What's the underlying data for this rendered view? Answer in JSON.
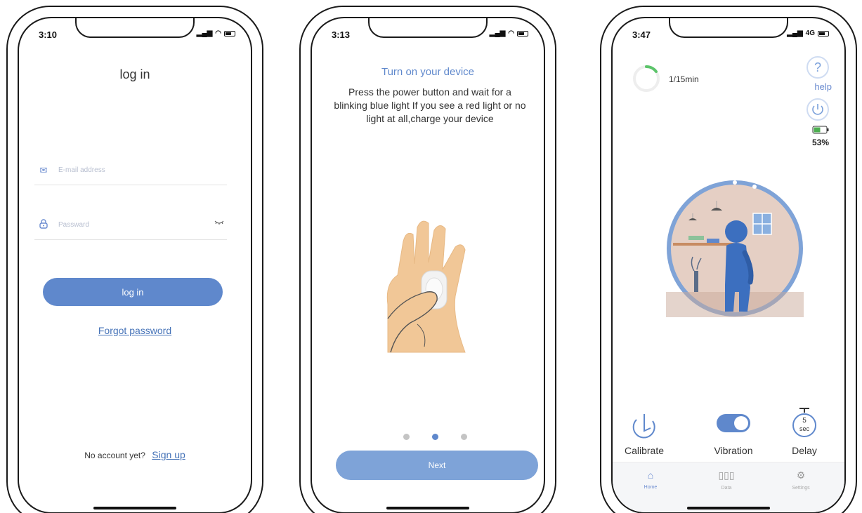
{
  "phones": [
    {
      "time": "3:10",
      "status_icons": [
        "signal-icon",
        "wifi-icon",
        "battery-icon"
      ],
      "title": "log in",
      "email_placeholder": "E-mail address",
      "password_placeholder": "Passward",
      "login_button": "log in",
      "forgot_password": "Forgot password",
      "no_account": "No account yet?",
      "sign_up": "Sign up"
    },
    {
      "time": "3:13",
      "status_icons": [
        "signal-icon",
        "wifi-icon",
        "battery-icon"
      ],
      "title": "Turn on your device",
      "instructions": "Press the power button and wait for a blinking blue light If you see a red light or no light at all,charge your device",
      "page_indicator": {
        "total": 3,
        "active": 2
      },
      "next_button": "Next"
    },
    {
      "time": "3:47",
      "network": "4G",
      "status_icons": [
        "signal-icon",
        "battery-icon"
      ],
      "timer_text": "1/15min",
      "help_label": "help",
      "battery_percent": "53%",
      "controls": [
        {
          "label": "Calibrate",
          "icon": "calibrate-icon"
        },
        {
          "label": "Vibration",
          "icon": "toggle-icon",
          "state": "on"
        },
        {
          "label": "Delay",
          "icon": "stopwatch-icon",
          "value": "5",
          "unit": "sec"
        }
      ],
      "tabs": [
        {
          "label": "Home",
          "icon": "home-icon",
          "active": true
        },
        {
          "label": "Data",
          "icon": "bar-chart-icon",
          "active": false
        },
        {
          "label": "Settings",
          "icon": "gear-icon",
          "active": false
        }
      ]
    }
  ],
  "colors": {
    "accent": "#5f88cc",
    "accent_light": "#7ea3d8",
    "battery_green": "#4caf50",
    "progress_green": "#5cc46a"
  }
}
